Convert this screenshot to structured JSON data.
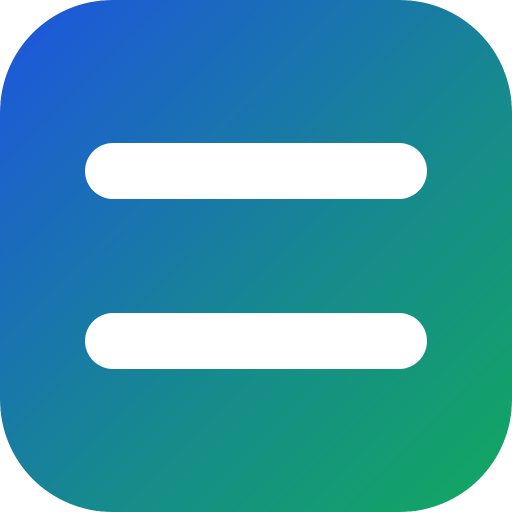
{
  "icon": {
    "name": "equals-icon",
    "gradient": {
      "start_color": "#1e54e0",
      "end_color": "#12a85f"
    },
    "bar_color": "#ffffff"
  }
}
